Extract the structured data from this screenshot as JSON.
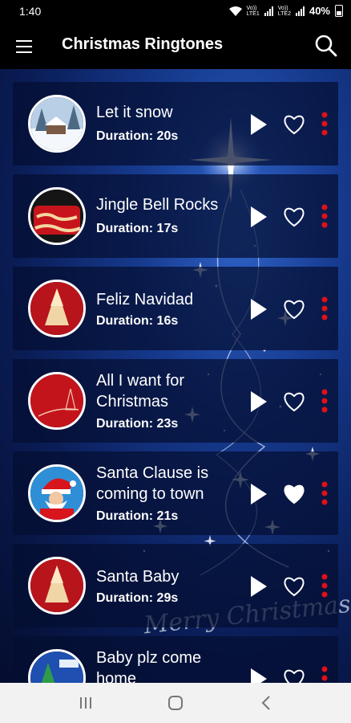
{
  "status_bar": {
    "time": "1:40",
    "sim1": "Vo))\nLTE1",
    "sim2": "Vo))\nLTE2",
    "battery": "40%"
  },
  "app_bar": {
    "title": "Christmas Ringtones",
    "menu_icon": "hamburger-menu-icon",
    "search_icon": "search-icon"
  },
  "background_text": "Merry Christmas !",
  "ringtones": [
    {
      "title": "Let it snow",
      "duration": "Duration: 20s",
      "thumb": "snowy-house",
      "favorite": false
    },
    {
      "title": "Jingle Bell Rocks",
      "duration": "Duration: 17s",
      "thumb": "merry-christmas-sign",
      "favorite": false
    },
    {
      "title": "Feliz Navidad",
      "duration": "Duration: 16s",
      "thumb": "gold-tree",
      "favorite": false
    },
    {
      "title": "All I want for Christmas",
      "duration": "Duration: 23s",
      "thumb": "red-swirl",
      "favorite": false
    },
    {
      "title": "Santa Clause is coming to town",
      "duration": "Duration: 21s",
      "thumb": "santa",
      "favorite": true
    },
    {
      "title": "Santa Baby",
      "duration": "Duration: 29s",
      "thumb": "gold-tree",
      "favorite": false
    },
    {
      "title": "Baby plz come home",
      "duration": "",
      "thumb": "blue-tree",
      "favorite": false
    }
  ],
  "colors": {
    "accent": "#e0101a",
    "card_bg": "#06123a",
    "bg_blue": "#163a8e"
  },
  "nav_bar": {
    "recents": "recents-icon",
    "home": "home-icon",
    "back": "back-icon"
  }
}
